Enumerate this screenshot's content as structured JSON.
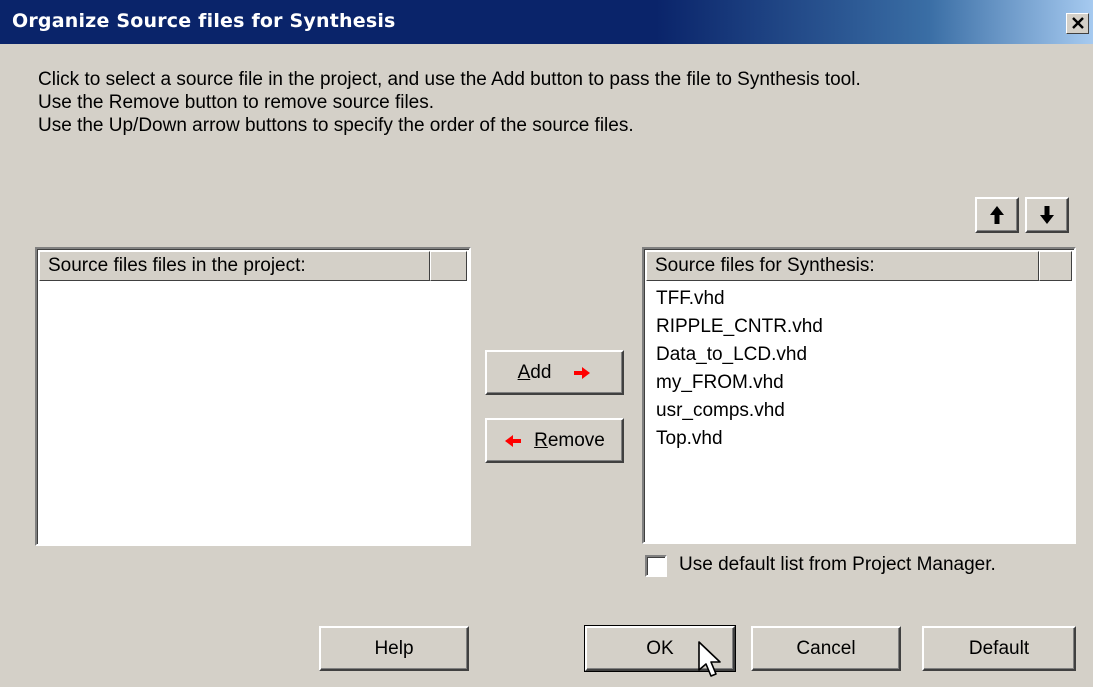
{
  "window": {
    "title": "Organize Source files for Synthesis",
    "close_glyph": "✕"
  },
  "instructions": [
    "Click to select a source file in the project, and use the Add button to pass the file to Synthesis tool.",
    "Use the Remove button to remove source files.",
    "Use the Up/Down arrow buttons to specify the order of the source files."
  ],
  "left_list": {
    "header": "Source files files in the project:",
    "items": []
  },
  "right_list": {
    "header": "Source files for Synthesis:",
    "items": [
      "TFF.vhd",
      "RIPPLE_CNTR.vhd",
      "Data_to_LCD.vhd",
      "my_FROM.vhd",
      "usr_comps.vhd",
      "Top.vhd"
    ]
  },
  "buttons": {
    "add_accel": "A",
    "add_rest": "dd",
    "remove_accel": "R",
    "remove_rest": "emove",
    "help": "Help",
    "ok": "OK",
    "cancel": "Cancel",
    "default": "Default"
  },
  "checkbox": {
    "label": "Use default list from Project Manager.",
    "checked": false
  },
  "icons": {
    "up": "arrow-up-icon",
    "down": "arrow-down-icon",
    "add_arrow": "red-right-arrow-icon",
    "remove_arrow": "red-left-arrow-icon",
    "cursor": "mouse-pointer-icon"
  },
  "colors": {
    "titlebar": "#0a246a",
    "face": "#d4d0c8",
    "arrow_red": "#ff0000"
  }
}
